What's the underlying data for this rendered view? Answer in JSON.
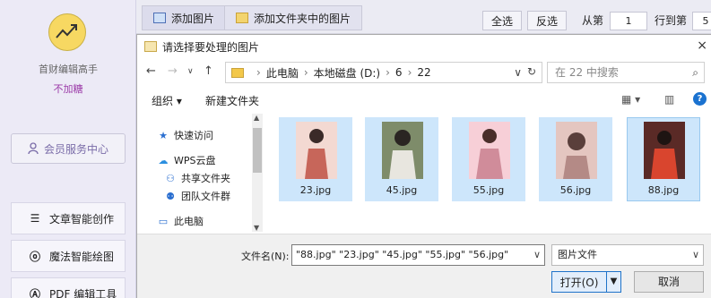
{
  "sidebar": {
    "app_name": "首财编辑高手",
    "user_name": "不加糖",
    "member_button": "会员服务中心",
    "nav": [
      {
        "label": "文章智能创作",
        "icon": "list-icon"
      },
      {
        "label": "魔法智能绘图",
        "icon": "magic-wand-icon"
      },
      {
        "label": "PDF 编辑工具",
        "icon": "pdf-icon"
      }
    ]
  },
  "toolbar": {
    "add_image": "添加图片",
    "add_folder_images": "添加文件夹中的图片",
    "select_all": "全选",
    "invert": "反选",
    "from_label": "从第",
    "from_value": "1",
    "to_label": "行到第",
    "to_value": "5"
  },
  "dialog": {
    "title": "请选择要处理的图片",
    "close": "×",
    "path": [
      "此电脑",
      "本地磁盘 (D:)",
      "6",
      "22"
    ],
    "search_placeholder": "在 22 中搜索",
    "organize": "组织 ▾",
    "new_folder": "新建文件夹",
    "tree": [
      {
        "label": "快速访问",
        "icon": "star-icon"
      },
      {
        "label": "WPS云盘",
        "icon": "cloud-icon"
      },
      {
        "label": "共享文件夹",
        "icon": "share-icon"
      },
      {
        "label": "团队文件群",
        "icon": "team-icon"
      },
      {
        "label": "此电脑",
        "icon": "computer-icon"
      }
    ],
    "files": [
      {
        "name": "23.jpg",
        "bg": "#f3d9d2",
        "fg": "#c7665a"
      },
      {
        "name": "45.jpg",
        "bg": "#7e8c6a",
        "fg": "#e8e6df"
      },
      {
        "name": "55.jpg",
        "bg": "#f7cfd7",
        "fg": "#d08c9a"
      },
      {
        "name": "56.jpg",
        "bg": "#e4c6c0",
        "fg": "#b48a86"
      },
      {
        "name": "88.jpg",
        "bg": "#5a2a26",
        "fg": "#d9452e"
      }
    ],
    "filename_label": "文件名(N):",
    "filename_value": "\"88.jpg\" \"23.jpg\" \"45.jpg\" \"55.jpg\" \"56.jpg\"",
    "filetype": "图片文件",
    "open_label": "打开(O)",
    "cancel_label": "取消"
  },
  "colors": {
    "accent": "#9b3aa8",
    "selection": "#cde6fb",
    "primary_button_border": "#1f73c9"
  }
}
